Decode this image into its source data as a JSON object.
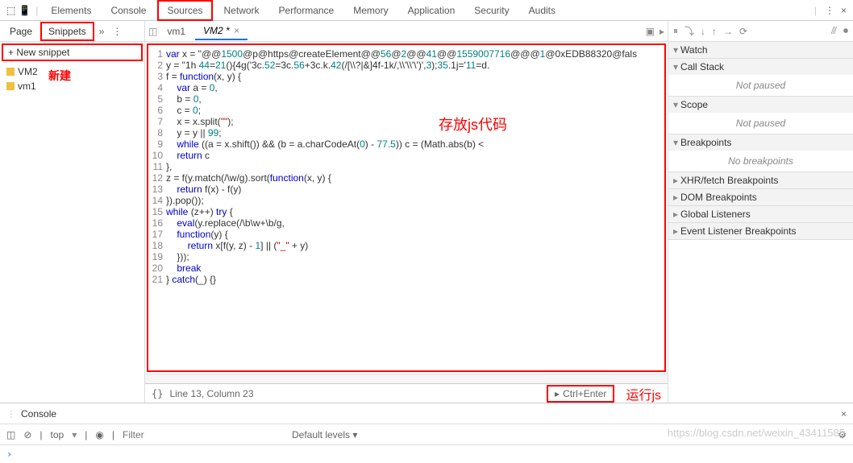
{
  "topTabs": {
    "items": [
      "Elements",
      "Console",
      "Sources",
      "Network",
      "Performance",
      "Memory",
      "Application",
      "Security",
      "Audits"
    ],
    "activeIndex": 2,
    "moreIcon": "⋮",
    "closeIcon": "×"
  },
  "leftPane": {
    "subTabs": {
      "page": "Page",
      "snippets": "Snippets",
      "chevron": "»",
      "moreIcon": "⋮"
    },
    "newSnippet": "+ New snippet",
    "newAnnotation": "新建",
    "snippets": [
      {
        "name": "VM2"
      },
      {
        "name": "vm1"
      }
    ]
  },
  "editor": {
    "tabs": [
      {
        "name": "vm1",
        "active": false
      },
      {
        "name": "VM2 *",
        "active": true
      }
    ],
    "rightIcons": [
      "▣",
      "▸"
    ],
    "codeAnnotation": "存放js代码",
    "codeLines": [
      "var x = \"@@1500@p@https@createElement@@56@2@@41@@1559007716@@@1@0xEDB88320@fals",
      "y = \"1h 44=21(){4g('3c.52=3c.56+3c.k.42(/[\\\\?|&]4f-1k/,\\\\'\\\\'\\')',3);35.1j='11=d.",
      "f = function(x, y) {",
      "    var a = 0,",
      "    b = 0,",
      "    c = 0;",
      "    x = x.split(\"\");",
      "    y = y || 99;",
      "    while ((a = x.shift()) && (b = a.charCodeAt(0) - 77.5)) c = (Math.abs(b) <",
      "    return c",
      "},",
      "z = f(y.match(/\\w/g).sort(function(x, y) {",
      "    return f(x) - f(y)",
      "}).pop());",
      "while (z++) try {",
      "    eval(y.replace(/\\b\\w+\\b/g,",
      "    function(y) {",
      "        return x[f(y, z) - 1] || (\"_\" + y)",
      "    }));",
      "    break",
      "} catch(_) {}"
    ],
    "statusBrace": "{}",
    "statusText": "Line 13, Column 23",
    "runButton": "Ctrl+Enter",
    "runIcon": "▸",
    "runAnnotation": "运行js"
  },
  "rightPane": {
    "toolbar": [
      "⏸",
      "⤵",
      "↓",
      "↑",
      "→",
      "⟳",
      "⫻",
      "⏺"
    ],
    "sections": [
      {
        "title": "Watch",
        "expanded": true,
        "body": null
      },
      {
        "title": "Call Stack",
        "expanded": true,
        "body": "Not paused"
      },
      {
        "title": "Scope",
        "expanded": true,
        "body": "Not paused"
      },
      {
        "title": "Breakpoints",
        "expanded": true,
        "body": "No breakpoints"
      },
      {
        "title": "XHR/fetch Breakpoints",
        "expanded": false,
        "body": null
      },
      {
        "title": "DOM Breakpoints",
        "expanded": false,
        "body": null
      },
      {
        "title": "Global Listeners",
        "expanded": false,
        "body": null
      },
      {
        "title": "Event Listener Breakpoints",
        "expanded": false,
        "body": null
      }
    ]
  },
  "console": {
    "title": "Console",
    "topContext": "top",
    "filterPlaceholder": "Filter",
    "levels": "Default levels ▾",
    "eyeIcon": "◉",
    "clearIcon": "⊘",
    "gearIcon": "⚙",
    "closeIcon": "×",
    "prompt": "›"
  },
  "watermark": "https://blog.csdn.net/weixin_43411585"
}
